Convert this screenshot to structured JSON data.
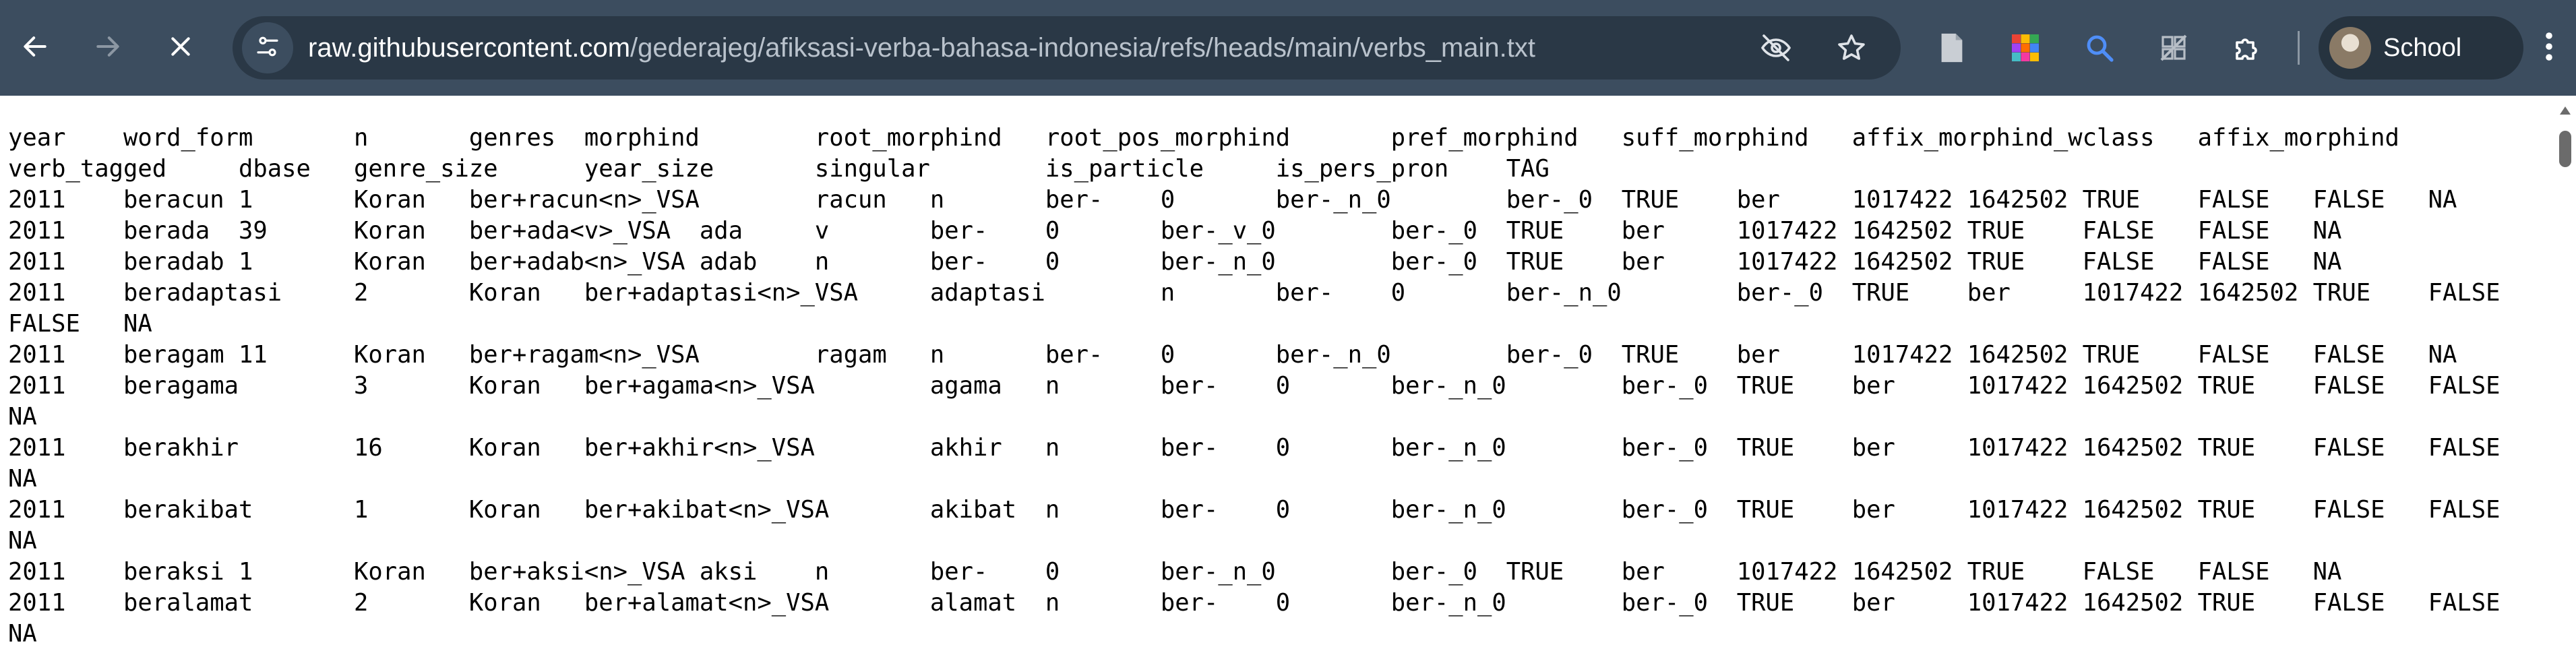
{
  "browser": {
    "url_host": "raw.githubusercontent.com",
    "url_path": "/gederajeg/afiksasi-verba-bahasa-indonesia/refs/heads/main/verbs_main.txt",
    "profile_name": "School",
    "colors": {
      "toolbar": "#3c4d5f",
      "omnibox": "#2a3846",
      "profile_chip": "#26333f"
    },
    "icons": [
      "back-icon",
      "forward-icon",
      "stop-icon",
      "site-info-icon",
      "eye-off-icon",
      "star-icon",
      "document-icon",
      "color-palette-icon",
      "search-lens-icon",
      "extension-icon",
      "puzzle-icon",
      "kebab-menu-icon"
    ]
  },
  "file": {
    "lines": [
      "year    word_form       n       genres  morphind        root_morphind   root_pos_morphind       pref_morphind   suff_morphind   affix_morphind_wclass   affix_morphind",
      "verb_tagged     dbase   genre_size      year_size       singular        is_particle     is_pers_pron    TAG",
      "2011    beracun 1       Koran   ber+racun<n>_VSA        racun   n       ber-    0       ber-_n_0        ber-_0  TRUE    ber     1017422 1642502 TRUE    FALSE   FALSE   NA",
      "2011    berada  39      Koran   ber+ada<v>_VSA  ada     v       ber-    0       ber-_v_0        ber-_0  TRUE    ber     1017422 1642502 TRUE    FALSE   FALSE   NA",
      "2011    beradab 1       Koran   ber+adab<n>_VSA adab    n       ber-    0       ber-_n_0        ber-_0  TRUE    ber     1017422 1642502 TRUE    FALSE   FALSE   NA",
      "2011    beradaptasi     2       Koran   ber+adaptasi<n>_VSA     adaptasi        n       ber-    0       ber-_n_0        ber-_0  TRUE    ber     1017422 1642502 TRUE    FALSE",
      "FALSE   NA",
      "2011    beragam 11      Koran   ber+ragam<n>_VSA        ragam   n       ber-    0       ber-_n_0        ber-_0  TRUE    ber     1017422 1642502 TRUE    FALSE   FALSE   NA",
      "2011    beragama        3       Koran   ber+agama<n>_VSA        agama   n       ber-    0       ber-_n_0        ber-_0  TRUE    ber     1017422 1642502 TRUE    FALSE   FALSE",
      "NA",
      "2011    berakhir        16      Koran   ber+akhir<n>_VSA        akhir   n       ber-    0       ber-_n_0        ber-_0  TRUE    ber     1017422 1642502 TRUE    FALSE   FALSE",
      "NA",
      "2011    berakibat       1       Koran   ber+akibat<n>_VSA       akibat  n       ber-    0       ber-_n_0        ber-_0  TRUE    ber     1017422 1642502 TRUE    FALSE   FALSE",
      "NA",
      "2011    beraksi 1       Koran   ber+aksi<n>_VSA aksi    n       ber-    0       ber-_n_0        ber-_0  TRUE    ber     1017422 1642502 TRUE    FALSE   FALSE   NA",
      "2011    beralamat       2       Koran   ber+alamat<n>_VSA       alamat  n       ber-    0       ber-_n_0        ber-_0  TRUE    ber     1017422 1642502 TRUE    FALSE   FALSE",
      "NA"
    ]
  }
}
